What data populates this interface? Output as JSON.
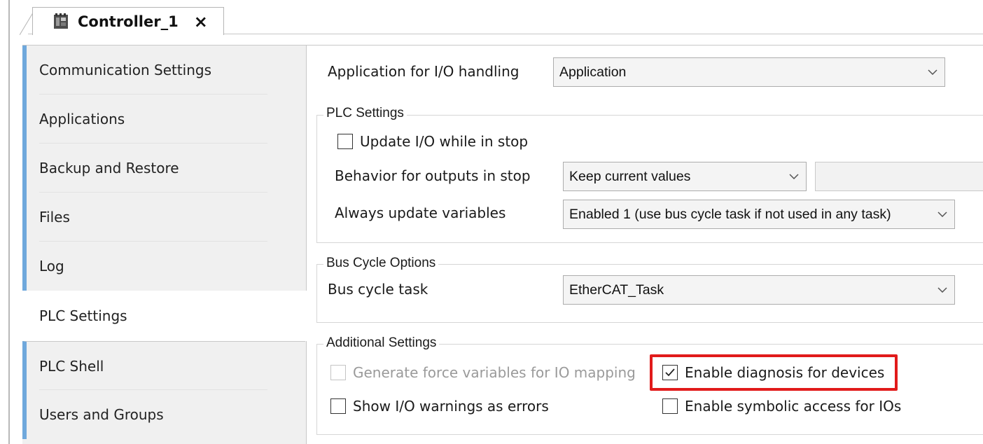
{
  "tab": {
    "title": "Controller_1",
    "close_glyph": "×",
    "icon": "controller-icon"
  },
  "nav": {
    "items": [
      {
        "label": "Communication Settings"
      },
      {
        "label": "Applications"
      },
      {
        "label": "Backup and Restore"
      },
      {
        "label": "Files"
      },
      {
        "label": "Log"
      },
      {
        "label": "PLC Settings",
        "active": true
      },
      {
        "label": "PLC Shell"
      },
      {
        "label": "Users and Groups"
      }
    ]
  },
  "main": {
    "app_io": {
      "label": "Application for I/O handling",
      "value": "Application"
    },
    "plc_settings": {
      "title": "PLC Settings",
      "update_io": {
        "label": "Update I/O while in stop",
        "checked": false
      },
      "behavior": {
        "label": "Behavior for outputs in stop",
        "value": "Keep current values",
        "extra_value": ""
      },
      "always_update": {
        "label": "Always update variables",
        "value": "Enabled 1 (use bus cycle task if not used in any task)"
      }
    },
    "bus_cycle": {
      "title": "Bus Cycle Options",
      "task": {
        "label": "Bus cycle task",
        "value": "EtherCAT_Task"
      }
    },
    "additional": {
      "title": "Additional Settings",
      "force_vars": {
        "label": "Generate force variables for IO mapping",
        "checked": false,
        "disabled": true
      },
      "enable_diag": {
        "label": "Enable diagnosis for devices",
        "checked": true,
        "highlighted": true
      },
      "show_warnings": {
        "label": "Show I/O warnings as errors",
        "checked": false
      },
      "symbolic_access": {
        "label": "Enable symbolic access for IOs",
        "checked": false
      }
    }
  },
  "colors": {
    "nav_accent": "#6fa8dc",
    "highlight": "#e11b1b",
    "nav_bg": "#f0f0f0"
  }
}
